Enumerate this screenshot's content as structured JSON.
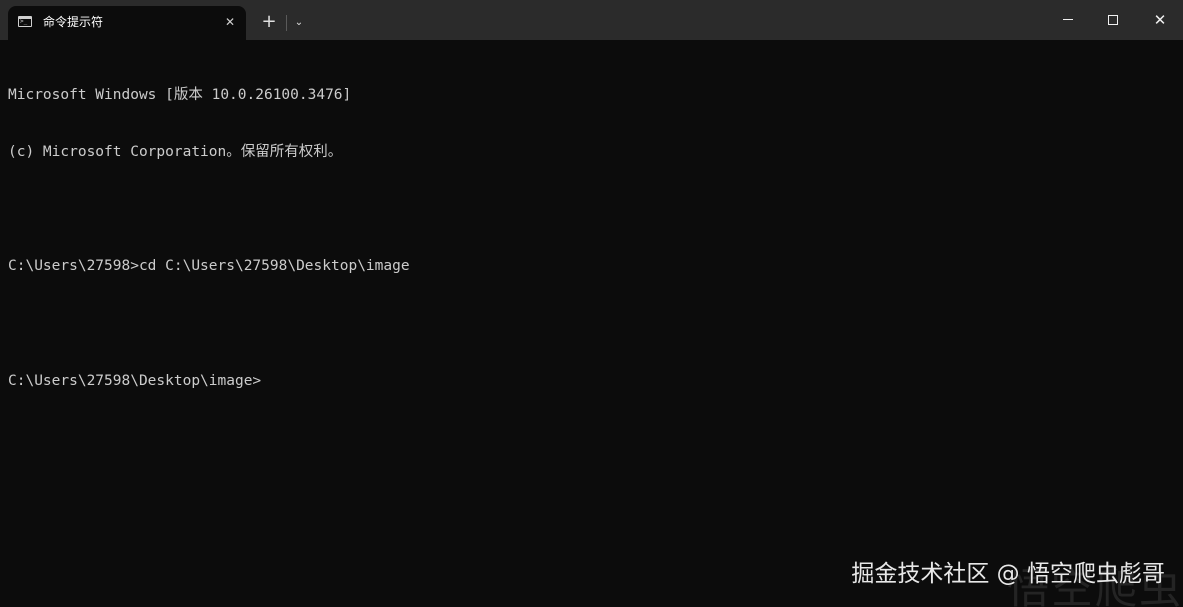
{
  "window": {
    "tab_title": "命令提示符",
    "tab_close": "✕",
    "new_tab": "+",
    "dropdown": "⌄",
    "close": "✕"
  },
  "icons": {
    "tab_icon": "cmd-icon",
    "tab_close": "close-icon",
    "new_tab": "plus-icon",
    "dropdown": "chevron-down-icon",
    "minimize": "minimize-icon",
    "maximize": "maximize-icon",
    "close": "close-icon"
  },
  "terminal": {
    "lines": [
      "Microsoft Windows [版本 10.0.26100.3476]",
      "(c) Microsoft Corporation。保留所有权利。",
      "",
      "C:\\Users\\27598>cd C:\\Users\\27598\\Desktop\\image",
      "",
      "C:\\Users\\27598\\Desktop\\image>"
    ]
  },
  "watermark": {
    "text": "掘金技术社区 @ 悟空爬虫彪哥",
    "big_text": "悟空爬虫"
  },
  "colors": {
    "background": "#0c0c0c",
    "titlebar": "#2b2b2b",
    "text": "#cccccc"
  }
}
